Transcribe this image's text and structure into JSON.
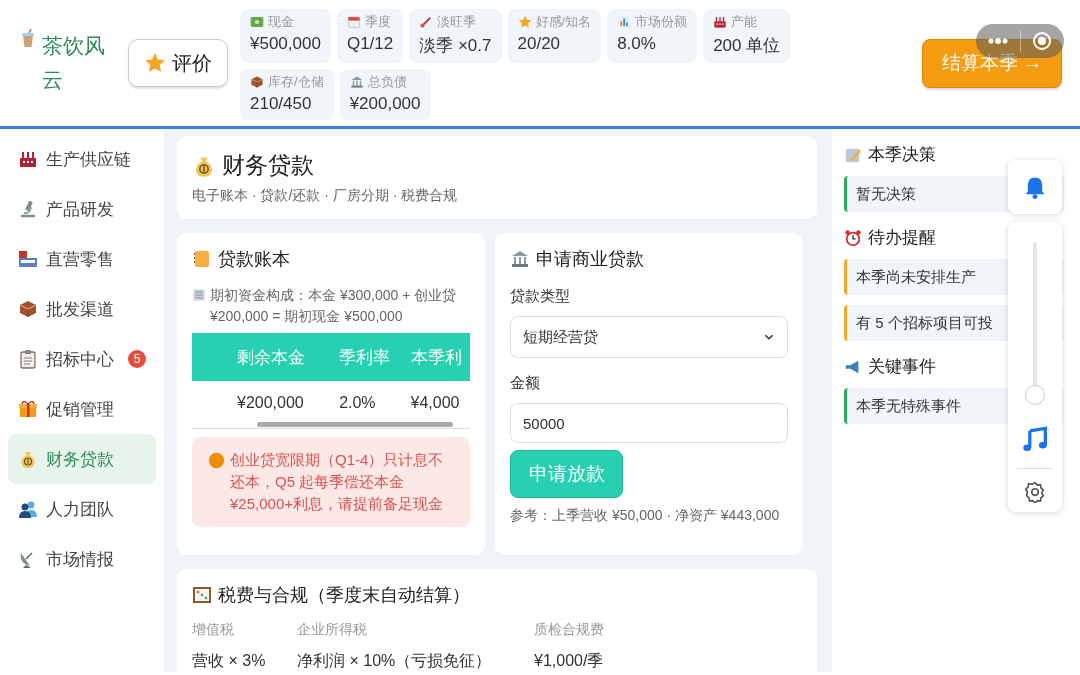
{
  "header": {
    "logo": "茶饮风云",
    "rate_button": "评价",
    "stats": [
      {
        "label": "现金",
        "value": "¥500,000"
      },
      {
        "label": "季度",
        "value": "Q1/12"
      },
      {
        "label": "淡旺季",
        "value": "淡季 ×0.7"
      },
      {
        "label": "好感/知名",
        "value": "20/20"
      },
      {
        "label": "市场份额",
        "value": "8.0%"
      },
      {
        "label": "产能",
        "value": "200 单位"
      },
      {
        "label": "库存/仓储",
        "value": "210/450"
      },
      {
        "label": "总负债",
        "value": "¥200,000"
      }
    ],
    "settle_button": "结算本季 →"
  },
  "sidebar": {
    "items": [
      {
        "label": "生产供应链",
        "selected": false
      },
      {
        "label": "产品研发",
        "selected": false
      },
      {
        "label": "直营零售",
        "selected": false
      },
      {
        "label": "批发渠道",
        "selected": false
      },
      {
        "label": "招标中心",
        "selected": false,
        "badge": "5"
      },
      {
        "label": "促销管理",
        "selected": false
      },
      {
        "label": "财务贷款",
        "selected": true
      },
      {
        "label": "人力团队",
        "selected": false
      },
      {
        "label": "市场情报",
        "selected": false
      }
    ]
  },
  "page": {
    "title": "财务贷款",
    "subtitle": "电子账本 · 贷款/还款 · 厂房分期 · 税费合规"
  },
  "ledger": {
    "title": "贷款账本",
    "note": "期初资金构成：本金 ¥300,000 + 创业贷 ¥200,000 = 期初现金 ¥500,000",
    "table": {
      "columns": [
        "剩余本金",
        "季利率",
        "本季利"
      ],
      "rows": [
        [
          "¥200,000",
          "2.0%",
          "¥4,000"
        ]
      ]
    },
    "warning": "创业贷宽限期（Q1-4）只计息不还本，Q5 起每季偿还本金 ¥25,000+利息，请提前备足现金"
  },
  "loan_form": {
    "title": "申请商业贷款",
    "type_label": "贷款类型",
    "type_value": "短期经营贷",
    "amount_label": "金额",
    "amount_value": "50000",
    "submit": "申请放款",
    "reference": "参考：上季营收 ¥50,000 · 净资产 ¥443,000"
  },
  "tax": {
    "title": "税费与合规（季度末自动结算）",
    "items": [
      {
        "label": "增值税",
        "value": "营收 × 3%"
      },
      {
        "label": "企业所得税",
        "value": "净利润 × 10%（亏损免征）"
      },
      {
        "label": "质检合规费",
        "value": "¥1,000/季"
      }
    ]
  },
  "right_panel": {
    "sections": [
      {
        "title": "本季决策",
        "items": [
          {
            "text": "暂无决策",
            "color": "#27ae60"
          }
        ]
      },
      {
        "title": "待办提醒",
        "items": [
          {
            "text": "本季尚未安排生产",
            "color": "#f0a92b"
          },
          {
            "text": "有 5 个招标项目可投",
            "color": "#f0a92b"
          }
        ]
      },
      {
        "title": "关键事件",
        "items": [
          {
            "text": "本季无特殊事件",
            "color": "#27ae60"
          }
        ]
      }
    ]
  },
  "floating": {
    "volume": {
      "level": 0.05
    }
  }
}
